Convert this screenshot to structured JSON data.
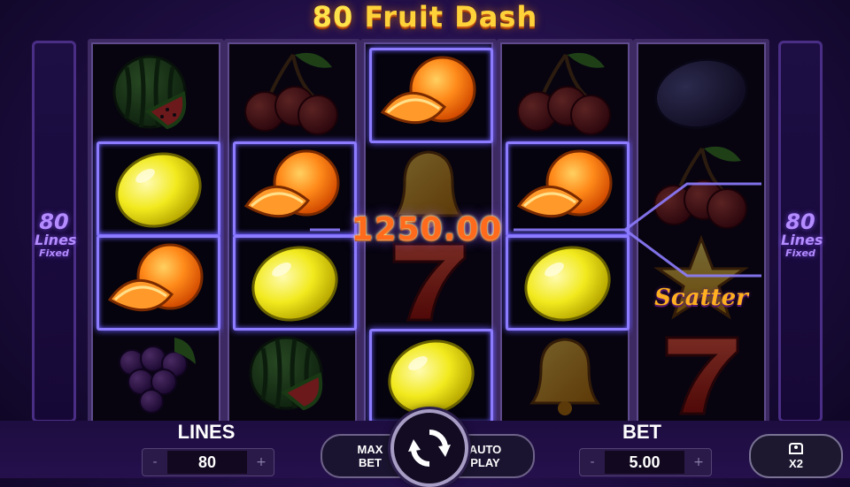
{
  "game": {
    "title_number": "80",
    "title_text": "Fruit Dash"
  },
  "side_panels": {
    "left": {
      "count": "80",
      "word": "Lines",
      "sub": "Fixed"
    },
    "right": {
      "count": "80",
      "word": "Lines",
      "sub": "Fixed"
    }
  },
  "reels": [
    {
      "symbols": [
        "watermelon",
        "lemon",
        "orange",
        "grapes"
      ]
    },
    {
      "symbols": [
        "cherries",
        "orange",
        "lemon",
        "watermelon"
      ]
    },
    {
      "symbols": [
        "orange",
        "bell",
        "seven",
        "lemon"
      ]
    },
    {
      "symbols": [
        "cherries",
        "orange",
        "lemon",
        "bell"
      ]
    },
    {
      "symbols": [
        "plum",
        "cherries",
        "scatter",
        "seven"
      ]
    }
  ],
  "scatter_label": "Scatter",
  "win_amount": "1250.00",
  "controls": {
    "lines_label": "LINES",
    "lines_value": "80",
    "lines_minus": "-",
    "lines_plus": "+",
    "max_bet": "MAX BET",
    "auto_play": "AUTO PLAY",
    "bet_label": "BET",
    "bet_value": "5.00",
    "bet_minus": "-",
    "bet_plus": "+",
    "speed_label": "X2",
    "spin_icon": "refresh-icon",
    "speed_icon": "hand-icon"
  },
  "colors": {
    "highlight": "#8d7cff",
    "title": "#ffd23a",
    "win": "#ff6a1c"
  }
}
